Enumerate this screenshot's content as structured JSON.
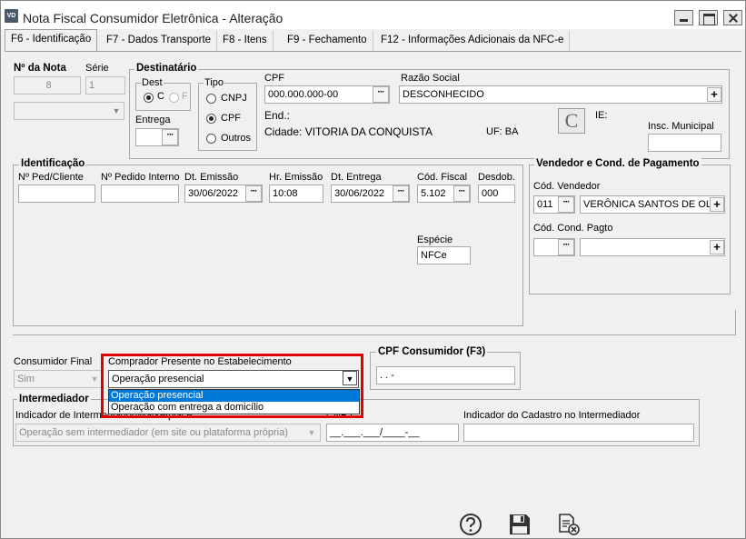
{
  "window": {
    "title": "Nota Fiscal Consumidor Eletrônica - Alteração",
    "icon_text": "VD"
  },
  "tabs": [
    {
      "label": "F6 - Identificação"
    },
    {
      "label": "F7 - Dados Transporte"
    },
    {
      "label": "F8 - Itens"
    },
    {
      "label": "F9 - Fechamento"
    },
    {
      "label": "F12 - Informações Adicionais da NFC-e"
    }
  ],
  "nota": {
    "label": "Nº da Nota",
    "value": "8",
    "serie_label": "Série",
    "serie_value": "1"
  },
  "destinatario": {
    "title": "Destinatário",
    "dest_label": "Dest",
    "opt_c": "C",
    "opt_f": "F",
    "entrega_label": "Entrega",
    "tipo_label": "Tipo",
    "tipo_cnpj": "CNPJ",
    "tipo_cpf": "CPF",
    "tipo_outros": "Outros",
    "cpf_label": "CPF",
    "cpf_value": "000.000.000-00",
    "razao_label": "Razão Social",
    "razao_value": "DESCONHECIDO",
    "end_label": "End.:",
    "cidade_text": "Cidade: VITORIA DA CONQUISTA",
    "uf_text": "UF: BA",
    "ie_label": "IE:",
    "insc_label": "Insc. Municipal",
    "c_button": "C"
  },
  "identificacao": {
    "title": "Identificação",
    "ped_cliente_label": "Nº Ped/Cliente",
    "ped_interno_label": "Nº Pedido Interno",
    "dt_emissao_label": "Dt. Emissão",
    "dt_emissao_value": "30/06/2022",
    "hr_emissao_label": "Hr. Emissão",
    "hr_emissao_value": "10:08",
    "dt_entrega_label": "Dt. Entrega",
    "dt_entrega_value": "30/06/2022",
    "cod_fiscal_label": "Cód. Fiscal",
    "cod_fiscal_value": "5.102",
    "desdob_label": "Desdob.",
    "desdob_value": "000",
    "especie_label": "Espécie",
    "especie_value": "NFCe"
  },
  "vendedor": {
    "title": "Vendedor e Cond. de Pagamento",
    "cod_vendedor_label": "Cód. Vendedor",
    "cod_vendedor_value": "011",
    "vendedor_nome": "VERÔNICA SANTOS DE OLIVEIRA",
    "cond_pagto_label": "Cód. Cond. Pagto"
  },
  "consumidor_final": {
    "label": "Consumidor Final",
    "value": "Sim"
  },
  "comprador": {
    "label": "Comprador Presente no Estabelecimento",
    "value": "Operação presencial",
    "options": [
      "Operação presencial",
      "Operação com entrega a domicílio"
    ]
  },
  "cpf_consumidor": {
    "title": "CPF Consumidor (F3)",
    "value": "  .   .   -"
  },
  "intermediador": {
    "title": "Intermediador",
    "indicador_label": "Indicador de Intermediador/Marketplace",
    "indicador_value": "Operação sem intermediador (em site ou plataforma própria)",
    "cnpj_label": "CNPJ",
    "cnpj_value": "__.___.___/____-__",
    "cadastro_label": "Indicador do Cadastro no Intermediador"
  },
  "colors": {
    "highlight_box": "#e00000",
    "selection": "#0078d7"
  },
  "bottom_icons": [
    "help-icon",
    "save-icon",
    "cancel-document-icon"
  ]
}
